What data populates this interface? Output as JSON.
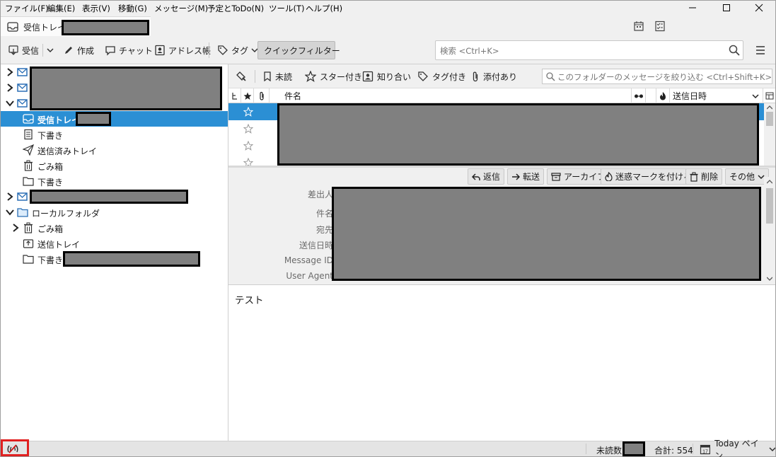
{
  "menubar": {
    "items": [
      "ファイル(F)",
      "編集(E)",
      "表示(V)",
      "移動(G)",
      "メッセージ(M)",
      "予定とToDo(N)",
      "ツール(T)",
      "ヘルプ(H)"
    ]
  },
  "tab": {
    "label": "受信トレイ -"
  },
  "toolbar": {
    "get_mail": "受信",
    "compose": "作成",
    "chat": "チャット",
    "address_book": "アドレス帳",
    "tag": "タグ",
    "quick_filter": "クイックフィルター",
    "search_placeholder": "検索 <Ctrl+K>"
  },
  "folders": {
    "inbox": "受信トレイ",
    "drafts": "下書き",
    "sent": "送信済みトレイ",
    "trash": "ごみ箱",
    "drafts2": "下書き",
    "local_folders": "ローカルフォルダ",
    "local_trash": "ごみ箱",
    "local_outbox": "送信トレイ",
    "local_drafts": "下書き-"
  },
  "quickfilter": {
    "unread": "未読",
    "starred": "スター付き",
    "contacts": "知り合い",
    "tagged": "タグ付き",
    "attachment": "添付あり",
    "placeholder": "このフォルダーのメッセージを絞り込む <Ctrl+Shift+K>"
  },
  "thread_columns": {
    "subject": "件名",
    "date": "送信日時"
  },
  "message_header": {
    "buttons": {
      "reply": "返信",
      "forward": "転送",
      "archive": "アーカイブ",
      "junk": "迷惑マークを付ける",
      "delete": "削除",
      "other": "その他"
    },
    "labels": {
      "from": "差出人",
      "subject": "件名",
      "to": "宛先",
      "date": "送信日時",
      "message_id": "Message ID",
      "user_agent": "User Agent"
    }
  },
  "message_body": {
    "text": "テスト"
  },
  "statusbar": {
    "unread_label": "未読数:",
    "total": "合計: 554",
    "today_pane": "Today ペイン"
  },
  "colors": {
    "selection": "#2b8fd4",
    "chrome": "#f0f0f0",
    "highlight_box": "#e02020"
  }
}
